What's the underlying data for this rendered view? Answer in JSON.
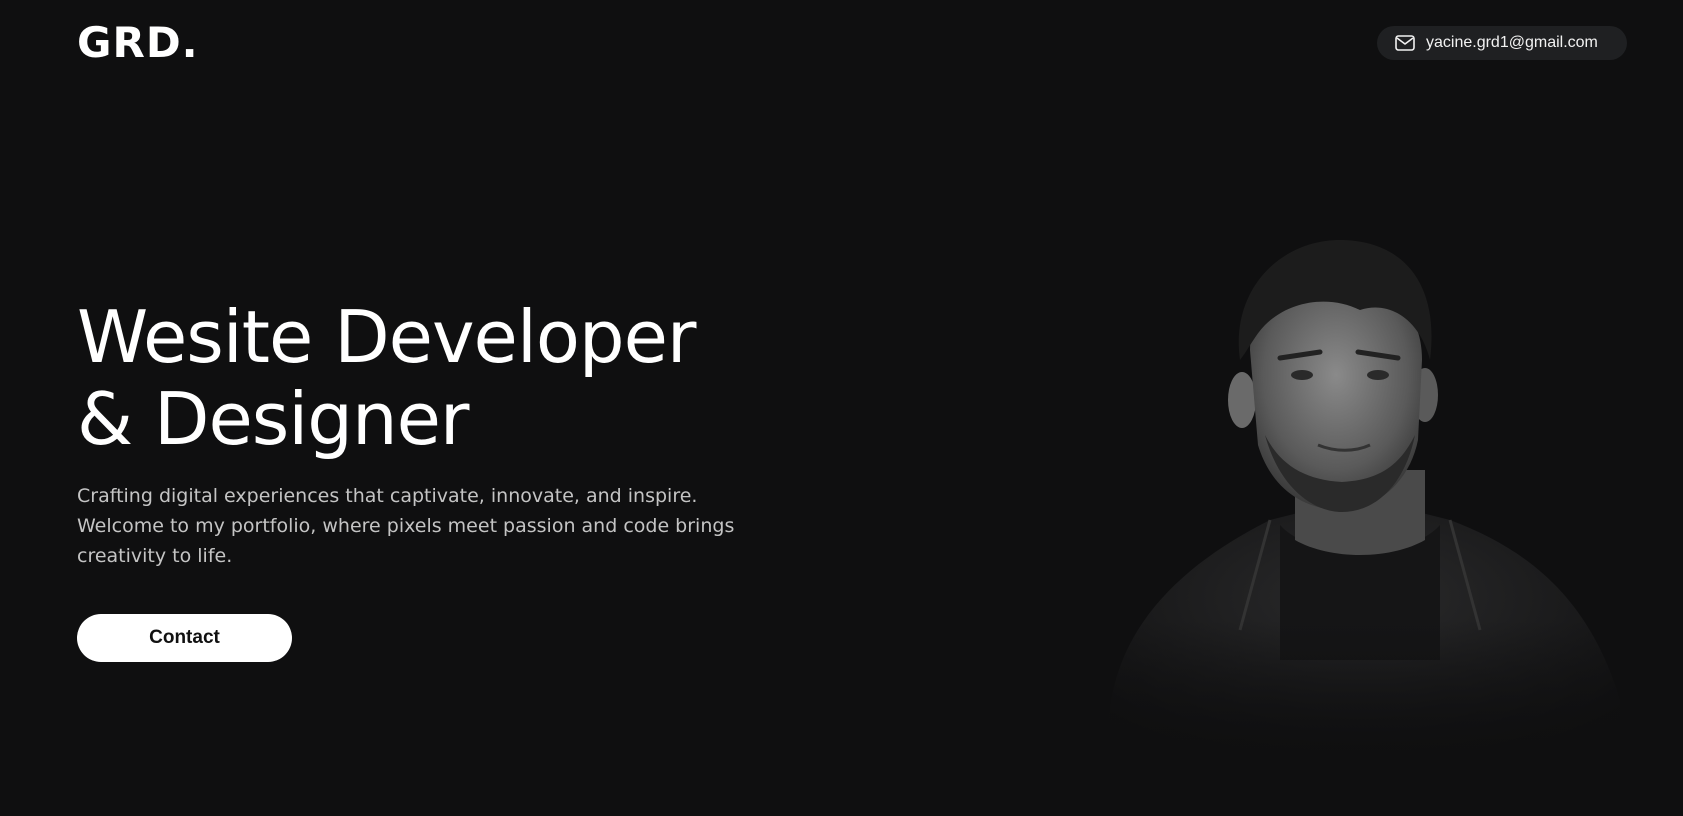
{
  "header": {
    "logo": "GRD.",
    "email": "yacine.grd1@gmail.com",
    "email_icon": "mail-icon"
  },
  "hero": {
    "title_line1": "Wesite Developer",
    "title_line2": "& Designer",
    "description_line1": "Crafting digital experiences that captivate, innovate, and inspire.",
    "description_line2": "Welcome to my portfolio, where pixels meet passion and code brings",
    "description_line3": "creativity to life.",
    "contact_label": "Contact"
  },
  "colors": {
    "background": "#0f0f10",
    "pill": "#1f2022",
    "text": "#ffffff",
    "muted_text": "#c4c4c4",
    "button": "#ffffff"
  }
}
